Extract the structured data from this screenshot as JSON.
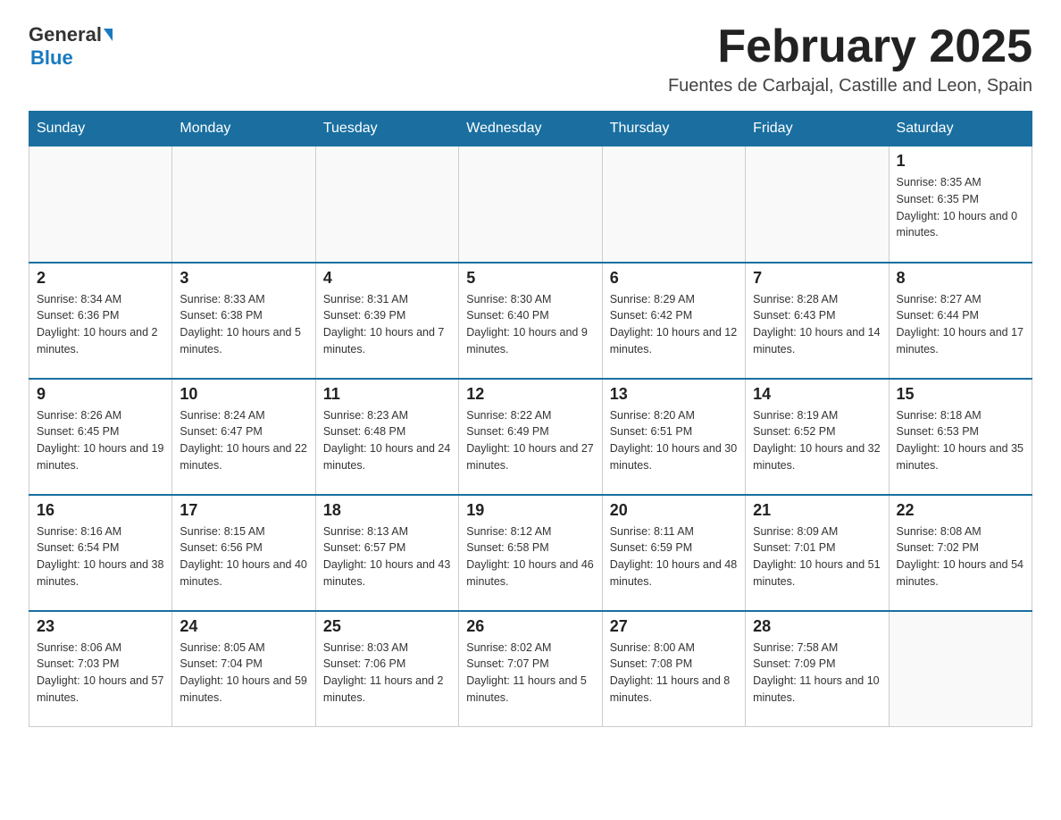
{
  "header": {
    "logo_general": "General",
    "logo_blue": "Blue",
    "month_title": "February 2025",
    "location": "Fuentes de Carbajal, Castille and Leon, Spain"
  },
  "days_of_week": [
    "Sunday",
    "Monday",
    "Tuesday",
    "Wednesday",
    "Thursday",
    "Friday",
    "Saturday"
  ],
  "weeks": [
    [
      {
        "day": "",
        "sunrise": "",
        "sunset": "",
        "daylight": ""
      },
      {
        "day": "",
        "sunrise": "",
        "sunset": "",
        "daylight": ""
      },
      {
        "day": "",
        "sunrise": "",
        "sunset": "",
        "daylight": ""
      },
      {
        "day": "",
        "sunrise": "",
        "sunset": "",
        "daylight": ""
      },
      {
        "day": "",
        "sunrise": "",
        "sunset": "",
        "daylight": ""
      },
      {
        "day": "",
        "sunrise": "",
        "sunset": "",
        "daylight": ""
      },
      {
        "day": "1",
        "sunrise": "Sunrise: 8:35 AM",
        "sunset": "Sunset: 6:35 PM",
        "daylight": "Daylight: 10 hours and 0 minutes."
      }
    ],
    [
      {
        "day": "2",
        "sunrise": "Sunrise: 8:34 AM",
        "sunset": "Sunset: 6:36 PM",
        "daylight": "Daylight: 10 hours and 2 minutes."
      },
      {
        "day": "3",
        "sunrise": "Sunrise: 8:33 AM",
        "sunset": "Sunset: 6:38 PM",
        "daylight": "Daylight: 10 hours and 5 minutes."
      },
      {
        "day": "4",
        "sunrise": "Sunrise: 8:31 AM",
        "sunset": "Sunset: 6:39 PM",
        "daylight": "Daylight: 10 hours and 7 minutes."
      },
      {
        "day": "5",
        "sunrise": "Sunrise: 8:30 AM",
        "sunset": "Sunset: 6:40 PM",
        "daylight": "Daylight: 10 hours and 9 minutes."
      },
      {
        "day": "6",
        "sunrise": "Sunrise: 8:29 AM",
        "sunset": "Sunset: 6:42 PM",
        "daylight": "Daylight: 10 hours and 12 minutes."
      },
      {
        "day": "7",
        "sunrise": "Sunrise: 8:28 AM",
        "sunset": "Sunset: 6:43 PM",
        "daylight": "Daylight: 10 hours and 14 minutes."
      },
      {
        "day": "8",
        "sunrise": "Sunrise: 8:27 AM",
        "sunset": "Sunset: 6:44 PM",
        "daylight": "Daylight: 10 hours and 17 minutes."
      }
    ],
    [
      {
        "day": "9",
        "sunrise": "Sunrise: 8:26 AM",
        "sunset": "Sunset: 6:45 PM",
        "daylight": "Daylight: 10 hours and 19 minutes."
      },
      {
        "day": "10",
        "sunrise": "Sunrise: 8:24 AM",
        "sunset": "Sunset: 6:47 PM",
        "daylight": "Daylight: 10 hours and 22 minutes."
      },
      {
        "day": "11",
        "sunrise": "Sunrise: 8:23 AM",
        "sunset": "Sunset: 6:48 PM",
        "daylight": "Daylight: 10 hours and 24 minutes."
      },
      {
        "day": "12",
        "sunrise": "Sunrise: 8:22 AM",
        "sunset": "Sunset: 6:49 PM",
        "daylight": "Daylight: 10 hours and 27 minutes."
      },
      {
        "day": "13",
        "sunrise": "Sunrise: 8:20 AM",
        "sunset": "Sunset: 6:51 PM",
        "daylight": "Daylight: 10 hours and 30 minutes."
      },
      {
        "day": "14",
        "sunrise": "Sunrise: 8:19 AM",
        "sunset": "Sunset: 6:52 PM",
        "daylight": "Daylight: 10 hours and 32 minutes."
      },
      {
        "day": "15",
        "sunrise": "Sunrise: 8:18 AM",
        "sunset": "Sunset: 6:53 PM",
        "daylight": "Daylight: 10 hours and 35 minutes."
      }
    ],
    [
      {
        "day": "16",
        "sunrise": "Sunrise: 8:16 AM",
        "sunset": "Sunset: 6:54 PM",
        "daylight": "Daylight: 10 hours and 38 minutes."
      },
      {
        "day": "17",
        "sunrise": "Sunrise: 8:15 AM",
        "sunset": "Sunset: 6:56 PM",
        "daylight": "Daylight: 10 hours and 40 minutes."
      },
      {
        "day": "18",
        "sunrise": "Sunrise: 8:13 AM",
        "sunset": "Sunset: 6:57 PM",
        "daylight": "Daylight: 10 hours and 43 minutes."
      },
      {
        "day": "19",
        "sunrise": "Sunrise: 8:12 AM",
        "sunset": "Sunset: 6:58 PM",
        "daylight": "Daylight: 10 hours and 46 minutes."
      },
      {
        "day": "20",
        "sunrise": "Sunrise: 8:11 AM",
        "sunset": "Sunset: 6:59 PM",
        "daylight": "Daylight: 10 hours and 48 minutes."
      },
      {
        "day": "21",
        "sunrise": "Sunrise: 8:09 AM",
        "sunset": "Sunset: 7:01 PM",
        "daylight": "Daylight: 10 hours and 51 minutes."
      },
      {
        "day": "22",
        "sunrise": "Sunrise: 8:08 AM",
        "sunset": "Sunset: 7:02 PM",
        "daylight": "Daylight: 10 hours and 54 minutes."
      }
    ],
    [
      {
        "day": "23",
        "sunrise": "Sunrise: 8:06 AM",
        "sunset": "Sunset: 7:03 PM",
        "daylight": "Daylight: 10 hours and 57 minutes."
      },
      {
        "day": "24",
        "sunrise": "Sunrise: 8:05 AM",
        "sunset": "Sunset: 7:04 PM",
        "daylight": "Daylight: 10 hours and 59 minutes."
      },
      {
        "day": "25",
        "sunrise": "Sunrise: 8:03 AM",
        "sunset": "Sunset: 7:06 PM",
        "daylight": "Daylight: 11 hours and 2 minutes."
      },
      {
        "day": "26",
        "sunrise": "Sunrise: 8:02 AM",
        "sunset": "Sunset: 7:07 PM",
        "daylight": "Daylight: 11 hours and 5 minutes."
      },
      {
        "day": "27",
        "sunrise": "Sunrise: 8:00 AM",
        "sunset": "Sunset: 7:08 PM",
        "daylight": "Daylight: 11 hours and 8 minutes."
      },
      {
        "day": "28",
        "sunrise": "Sunrise: 7:58 AM",
        "sunset": "Sunset: 7:09 PM",
        "daylight": "Daylight: 11 hours and 10 minutes."
      },
      {
        "day": "",
        "sunrise": "",
        "sunset": "",
        "daylight": ""
      }
    ]
  ]
}
